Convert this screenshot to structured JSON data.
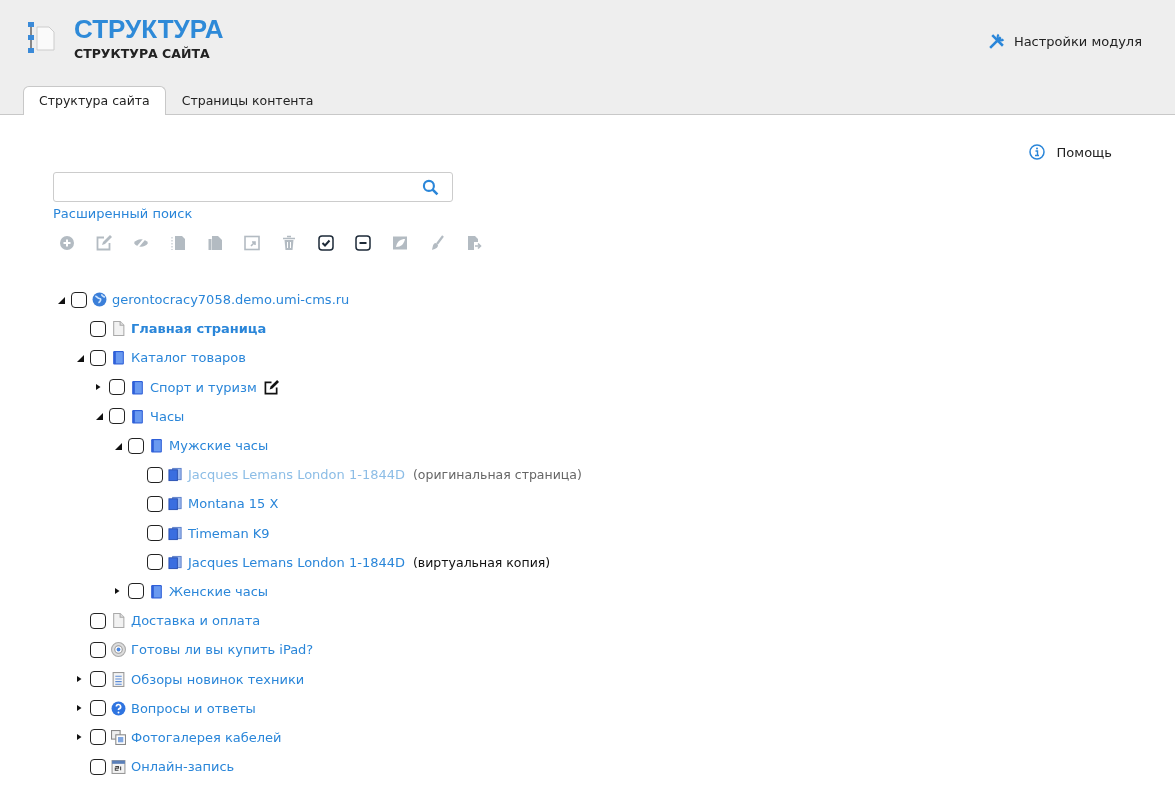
{
  "header": {
    "title": "СТРУКТУРА",
    "subtitle": "СТРУКТУРА САЙТА",
    "settings_link": "Настройки модуля"
  },
  "tabs": [
    {
      "label": "Структура сайта",
      "selected": true
    },
    {
      "label": "Страницы контента",
      "selected": false
    }
  ],
  "help_link": "Помощь",
  "search": {
    "advanced_link": "Расширенный поиск"
  },
  "toolbar": [
    {
      "kind": "add",
      "disabled": true
    },
    {
      "kind": "edit",
      "disabled": true
    },
    {
      "kind": "hide",
      "disabled": true
    },
    {
      "kind": "copy-dotted",
      "disabled": true
    },
    {
      "kind": "copy",
      "disabled": true
    },
    {
      "kind": "open-window",
      "disabled": true
    },
    {
      "kind": "delete",
      "disabled": true
    },
    {
      "kind": "select-all",
      "disabled": false
    },
    {
      "kind": "deselect",
      "disabled": false
    },
    {
      "kind": "image",
      "disabled": true
    },
    {
      "kind": "brush",
      "disabled": true
    },
    {
      "kind": "move",
      "disabled": true
    }
  ],
  "tree": [
    {
      "label": "gerontocracy7058.demo.umi-cms.ru",
      "kind": "site",
      "checked": false,
      "expanded": true,
      "children": [
        {
          "label": "Главная страница",
          "kind": "home",
          "checked": false
        },
        {
          "label": "Каталог товаров",
          "kind": "catalog",
          "checked": false,
          "expanded": true,
          "children": [
            {
              "label": "Спорт и туризм",
              "kind": "catalog",
              "checked": false,
              "expanded": false,
              "editing": true
            },
            {
              "label": "Часы",
              "kind": "catalog",
              "checked": false,
              "expanded": true,
              "children": [
                {
                  "label": "Мужские часы",
                  "kind": "catalog",
                  "checked": false,
                  "expanded": true,
                  "children": [
                    {
                      "label": "Jacques Lemans London 1-1844D",
                      "kind": "object",
                      "checked": false,
                      "dimmed": true,
                      "note": {
                        "text": "(оригинальная страница)",
                        "kind": "original"
                      }
                    },
                    {
                      "label": "Montana 15 X",
                      "kind": "object",
                      "checked": false,
                      "dimmed": false
                    },
                    {
                      "label": "Timeman K9",
                      "kind": "object",
                      "checked": false,
                      "dimmed": false
                    },
                    {
                      "label": "Jacques Lemans London 1-1844D",
                      "kind": "object",
                      "checked": false,
                      "dimmed": false,
                      "note": {
                        "text": "(виртуальная копия)",
                        "kind": "virtual"
                      }
                    }
                  ]
                },
                {
                  "label": "Женские часы",
                  "kind": "catalog",
                  "checked": false,
                  "expanded": false
                }
              ]
            }
          ]
        },
        {
          "label": "Доставка и оплата",
          "kind": "page",
          "checked": false
        },
        {
          "label": "Готовы ли вы купить iPad?",
          "kind": "poll",
          "checked": false
        },
        {
          "label": "Обзоры новинок техники",
          "kind": "news",
          "checked": false,
          "expanded": false
        },
        {
          "label": "Вопросы и ответы",
          "kind": "faq",
          "checked": false,
          "expanded": false
        },
        {
          "label": "Фотогалерея кабелей",
          "kind": "gallery",
          "checked": false,
          "expanded": false
        },
        {
          "label": "Онлайн-запись",
          "kind": "calendar",
          "checked": false
        }
      ]
    }
  ]
}
